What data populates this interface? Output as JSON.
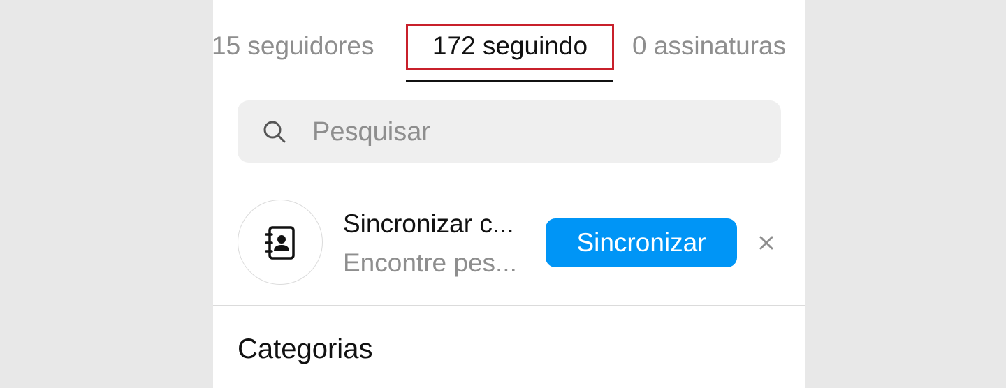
{
  "tabs": {
    "followers": "15 seguidores",
    "following": "172 seguindo",
    "subscriptions": "0 assinaturas"
  },
  "search": {
    "placeholder": "Pesquisar",
    "icon": "search-icon"
  },
  "sync_contacts": {
    "icon": "contacts-book-icon",
    "title": "Sincronizar c...",
    "subtitle": "Encontre pes...",
    "button_label": "Sincronizar",
    "close_icon": "close-icon"
  },
  "sections": {
    "categories_title": "Categorias"
  },
  "colors": {
    "accent": "#0095f6",
    "highlight_box": "#c8202b",
    "active_text": "#111111",
    "muted_text": "#8e8e8e",
    "search_bg": "#efefef"
  }
}
